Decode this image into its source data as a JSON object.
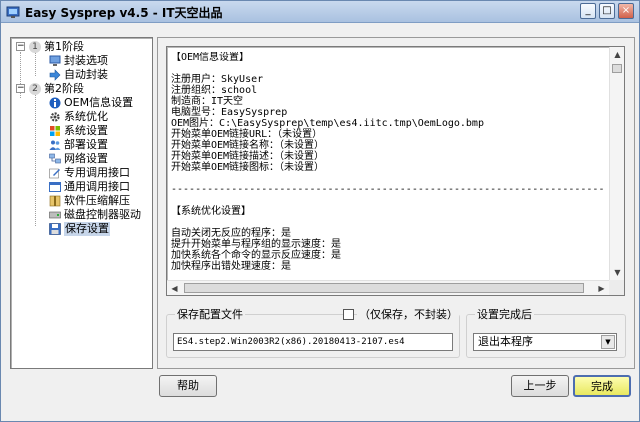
{
  "window": {
    "title": "Easy Sysprep v4.5 - IT天空出品",
    "controls": {
      "minimize": "_",
      "maximize": "□",
      "close": "×"
    }
  },
  "tree": {
    "stage1": {
      "num": "1",
      "label": "第1阶段",
      "expander": "−"
    },
    "stage1_items": [
      {
        "label": "封装选项",
        "icon": "monitor-icon"
      },
      {
        "label": "自动封装",
        "icon": "arrow-right-icon"
      }
    ],
    "stage2": {
      "num": "2",
      "label": "第2阶段",
      "expander": "−"
    },
    "stage2_items": [
      {
        "label": "OEM信息设置",
        "icon": "info-icon"
      },
      {
        "label": "系统优化",
        "icon": "gear-icon"
      },
      {
        "label": "系统设置",
        "icon": "windows-logo-icon"
      },
      {
        "label": "部署设置",
        "icon": "users-icon"
      },
      {
        "label": "网络设置",
        "icon": "network-icon"
      },
      {
        "label": "专用调用接口",
        "icon": "pen-icon"
      },
      {
        "label": "通用调用接口",
        "icon": "window-icon"
      },
      {
        "label": "软件压缩解压",
        "icon": "archive-icon"
      },
      {
        "label": "磁盘控制器驱动",
        "icon": "disk-icon"
      },
      {
        "label": "保存设置",
        "icon": "save-icon",
        "selected": true
      }
    ]
  },
  "summary": {
    "text": "【OEM信息设置】\n\n注册用户：SkyUser\n注册组织：school\n制造商：IT天空\n电脑型号：EasySysprep\nOEM图片：C:\\EasySysprep\\temp\\es4.iitc.tmp\\OemLogo.bmp\n开始菜单OEM链接URL：（未设置）\n开始菜单OEM链接名称：（未设置）\n开始菜单OEM链接描述：（未设置）\n开始菜单OEM链接图标：（未设置）\n\n------------------------------------------------------------------------\n\n【系统优化设置】\n\n自动关闭无反应的程序：是\n提升开始菜单与程序组的显示速度：是\n加快系统各个命令的显示反应速度：是\n加快程序出错处理速度：是"
  },
  "save_config": {
    "legend": "保存配置文件",
    "checkbox_label": "（仅保存，不封装）",
    "checked": false,
    "filename": "ES4.step2.Win2003R2(x86).20180413-2107.es4"
  },
  "after_setup": {
    "legend": "设置完成后",
    "selected": "退出本程序"
  },
  "buttons": {
    "help": "帮助",
    "back": "上一步",
    "finish": "完成"
  },
  "colors": {
    "selection": "#c7d6ea",
    "finish_button": "#e8e860"
  }
}
